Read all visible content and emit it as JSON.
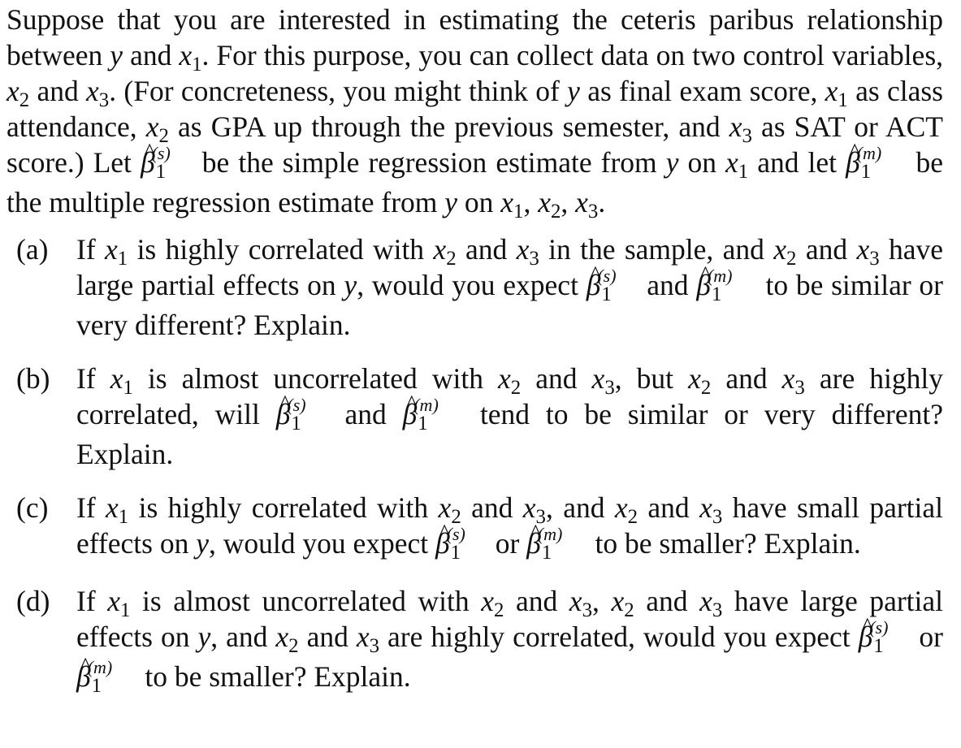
{
  "intro": {
    "segments": [
      "Suppose that you are interested in estimating the ceteris paribus relationship between ",
      "y",
      " and ",
      "x1",
      ". For this purpose, you can collect data on two control variables, ",
      "x2",
      " and ",
      "x3",
      ". (For concreteness, you might think of ",
      "y",
      " as final exam score, ",
      "x1",
      " as class attendance, ",
      "x2",
      " as GPA up through the previous semester, and ",
      "x3",
      " as SAT or ACT score.) Let ",
      "beta1(s)",
      " be the simple regression estimate from ",
      "y",
      " on ",
      "x1",
      " and let ",
      "beta1(m)",
      " be the multiple regression estimate from ",
      "y",
      " on ",
      "x1",
      ", ",
      "x2",
      ", ",
      "x3",
      "."
    ]
  },
  "symbols": {
    "y": "y",
    "x": "x",
    "beta": "β",
    "hat": "^",
    "s_sup": "(s)",
    "m_sup": "(m)",
    "sub1": "1",
    "sub2": "2",
    "sub3": "3"
  },
  "items": [
    {
      "label": "(a)",
      "parts": [
        "If ",
        "x1",
        " is highly correlated with ",
        "x2",
        " and ",
        "x3",
        " in the sample, and ",
        "x2",
        " and ",
        "x3",
        " have large partial effects on ",
        "y",
        ", would you expect ",
        "beta1(s)",
        " and ",
        "beta1(m)",
        " to be similar or very different? Explain."
      ]
    },
    {
      "label": "(b)",
      "parts": [
        "If ",
        "x1",
        " is almost uncorrelated with ",
        "x2",
        " and ",
        "x3",
        ", but ",
        "x2",
        " and ",
        "x3",
        " are highly correlated, will ",
        "beta1(s)",
        " and ",
        "beta1(m)",
        " tend to be similar or very different? Explain."
      ]
    },
    {
      "label": "(c)",
      "parts": [
        "If ",
        "x1",
        " is highly correlated with ",
        "x2",
        " and ",
        "x3",
        ", and ",
        "x2",
        " and ",
        "x3",
        " have small partial effects on ",
        "y",
        ", would you expect ",
        "beta1(s)",
        " or ",
        "beta1(m)",
        " to be smaller? Explain."
      ]
    },
    {
      "label": "(d)",
      "parts": [
        "If ",
        "x1",
        " is almost uncorrelated with ",
        "x2",
        " and ",
        "x3",
        ", ",
        "x2",
        " and ",
        "x3",
        " have large partial effects on ",
        "y",
        ", and ",
        "x2",
        " and ",
        "x3",
        " are highly correlated, would you expect ",
        "beta1(s)",
        " or ",
        "beta1(m)",
        " to be smaller? Explain."
      ]
    }
  ]
}
